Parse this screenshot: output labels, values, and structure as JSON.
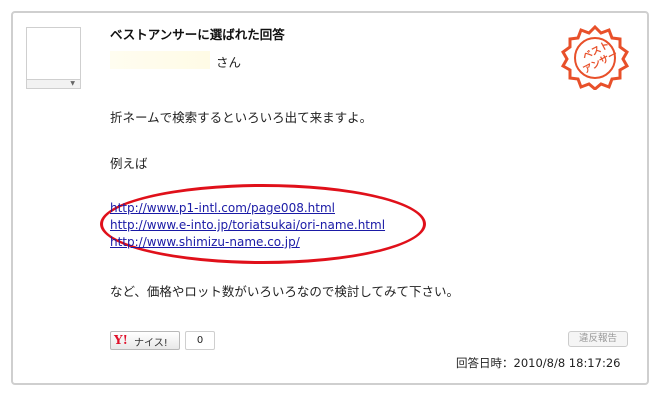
{
  "answer": {
    "title": "ベストアンサーに選ばれた回答",
    "user_suffix": "さん",
    "paragraphs": [
      "折ネームで検索するといろいろ出て来ますよ。",
      "例えば",
      "など、価格やロット数がいろいろなので検討してみて下さい。"
    ],
    "links": [
      "http://www.p1-intl.com/page008.html",
      "http://www.e-into.jp/toriatsukai/ori-name.html",
      "http://www.shimizu-name.co.jp/"
    ],
    "timestamp_label": "回答日時",
    "timestamp": "：2010/8/8 18:17:26"
  },
  "best_answer_stamp": {
    "lines": [
      "ベスト",
      "アンサー"
    ],
    "color": "#e8502a"
  },
  "actions": {
    "nice_logo": "Y!",
    "nice_label": "ナイス!",
    "nice_count": "0",
    "report_label": "違反報告"
  },
  "highlight_color": "#e0101a",
  "link_color": "#1a1aa6"
}
